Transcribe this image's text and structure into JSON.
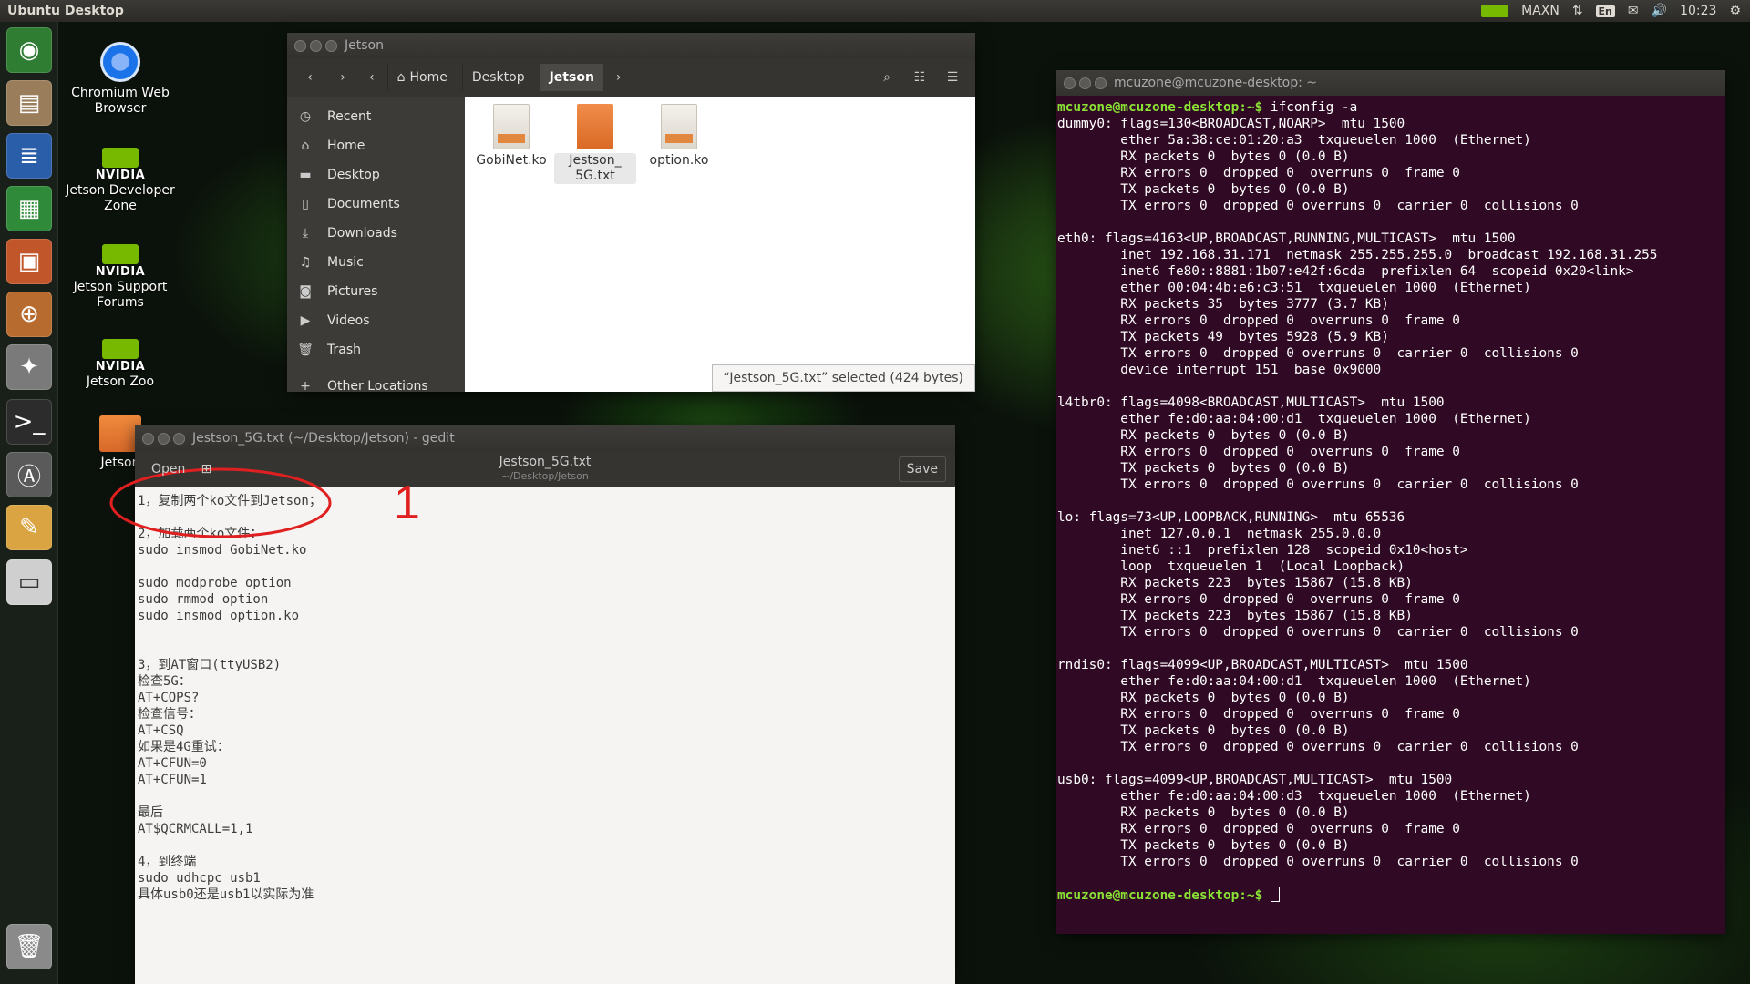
{
  "top_panel": {
    "title": "Ubuntu Desktop",
    "tray": {
      "power_mode": "MAXN",
      "keyboard": "En",
      "clock": "10:23"
    }
  },
  "launcher": {
    "items": [
      "ubuntu-dash-icon",
      "files-icon",
      "writer-icon",
      "calc-icon",
      "impress-icon",
      "software-center-icon",
      "system-settings-icon",
      "terminal-icon",
      "software-updater-icon",
      "text-editor-icon",
      "drive-icon",
      "trash-icon"
    ]
  },
  "desktop": {
    "icons": [
      {
        "label": "Chromium Web Browser"
      },
      {
        "brand": "NVIDIA",
        "label": "Jetson Developer Zone"
      },
      {
        "brand": "NVIDIA",
        "label": "Jetson Support Forums"
      },
      {
        "brand": "NVIDIA",
        "label": "Jetson Zoo"
      },
      {
        "label": "Jetson"
      }
    ]
  },
  "files_window": {
    "title": "Jetson",
    "breadcrumbs": [
      "Home",
      "Desktop",
      "Jetson"
    ],
    "sidebar": [
      "Recent",
      "Home",
      "Desktop",
      "Documents",
      "Downloads",
      "Music",
      "Pictures",
      "Videos",
      "Trash",
      "Other Locations"
    ],
    "files": [
      {
        "name": "GobiNet.ko",
        "type": "ko"
      },
      {
        "name": "Jestson_\n5G.txt",
        "type": "txt",
        "selected": true
      },
      {
        "name": "option.ko",
        "type": "ko"
      }
    ],
    "status": "“Jestson_5G.txt” selected  (424 bytes)"
  },
  "gedit_window": {
    "title": "Jestson_5G.txt (~/Desktop/Jetson) - gedit",
    "open_label": "Open",
    "doc_title": "Jestson_5G.txt",
    "doc_path": "~/Desktop/Jetson",
    "save_label": "Save",
    "annotation_number": "1",
    "lines": [
      "1，复制两个ko文件到Jetson；",
      "",
      "2，加载两个ko文件：",
      "sudo insmod GobiNet.ko",
      "",
      "sudo modprobe option",
      "sudo rmmod option",
      "sudo insmod option.ko",
      "",
      "",
      "3，到AT窗口(ttyUSB2)",
      "检查5G：",
      "AT+COPS?",
      "检查信号：",
      "AT+CSQ",
      "如果是4G重试：",
      "AT+CFUN=0",
      "AT+CFUN=1",
      "",
      "最后",
      "AT$QCRMCALL=1,1",
      "",
      "4，到终端",
      "sudo udhcpc usb1",
      "具体usb0还是usb1以实际为准"
    ]
  },
  "terminal_window": {
    "title": "mcuzone@mcuzone-desktop: ~",
    "prompt": "mcuzone@mcuzone-desktop:~$",
    "command": " ifconfig -a",
    "output": [
      "dummy0: flags=130<BROADCAST,NOARP>  mtu 1500",
      "        ether 5a:38:ce:01:20:a3  txqueuelen 1000  (Ethernet)",
      "        RX packets 0  bytes 0 (0.0 B)",
      "        RX errors 0  dropped 0  overruns 0  frame 0",
      "        TX packets 0  bytes 0 (0.0 B)",
      "        TX errors 0  dropped 0 overruns 0  carrier 0  collisions 0",
      "",
      "eth0: flags=4163<UP,BROADCAST,RUNNING,MULTICAST>  mtu 1500",
      "        inet 192.168.31.171  netmask 255.255.255.0  broadcast 192.168.31.255",
      "        inet6 fe80::8881:1b07:e42f:6cda  prefixlen 64  scopeid 0x20<link>",
      "        ether 00:04:4b:e6:c3:51  txqueuelen 1000  (Ethernet)",
      "        RX packets 35  bytes 3777 (3.7 KB)",
      "        RX errors 0  dropped 0  overruns 0  frame 0",
      "        TX packets 49  bytes 5928 (5.9 KB)",
      "        TX errors 0  dropped 0 overruns 0  carrier 0  collisions 0",
      "        device interrupt 151  base 0x9000",
      "",
      "l4tbr0: flags=4098<BROADCAST,MULTICAST>  mtu 1500",
      "        ether fe:d0:aa:04:00:d1  txqueuelen 1000  (Ethernet)",
      "        RX packets 0  bytes 0 (0.0 B)",
      "        RX errors 0  dropped 0  overruns 0  frame 0",
      "        TX packets 0  bytes 0 (0.0 B)",
      "        TX errors 0  dropped 0 overruns 0  carrier 0  collisions 0",
      "",
      "lo: flags=73<UP,LOOPBACK,RUNNING>  mtu 65536",
      "        inet 127.0.0.1  netmask 255.0.0.0",
      "        inet6 ::1  prefixlen 128  scopeid 0x10<host>",
      "        loop  txqueuelen 1  (Local Loopback)",
      "        RX packets 223  bytes 15867 (15.8 KB)",
      "        RX errors 0  dropped 0  overruns 0  frame 0",
      "        TX packets 223  bytes 15867 (15.8 KB)",
      "        TX errors 0  dropped 0 overruns 0  carrier 0  collisions 0",
      "",
      "rndis0: flags=4099<UP,BROADCAST,MULTICAST>  mtu 1500",
      "        ether fe:d0:aa:04:00:d1  txqueuelen 1000  (Ethernet)",
      "        RX packets 0  bytes 0 (0.0 B)",
      "        RX errors 0  dropped 0  overruns 0  frame 0",
      "        TX packets 0  bytes 0 (0.0 B)",
      "        TX errors 0  dropped 0 overruns 0  carrier 0  collisions 0",
      "",
      "usb0: flags=4099<UP,BROADCAST,MULTICAST>  mtu 1500",
      "        ether fe:d0:aa:04:00:d3  txqueuelen 1000  (Ethernet)",
      "        RX packets 0  bytes 0 (0.0 B)",
      "        RX errors 0  dropped 0  overruns 0  frame 0",
      "        TX packets 0  bytes 0 (0.0 B)",
      "        TX errors 0  dropped 0 overruns 0  carrier 0  collisions 0",
      ""
    ]
  },
  "colors": {
    "terminal_bg": "#300a24",
    "prompt": "#8ae234",
    "nvidia": "#76b900",
    "annotation": "#e02020"
  }
}
